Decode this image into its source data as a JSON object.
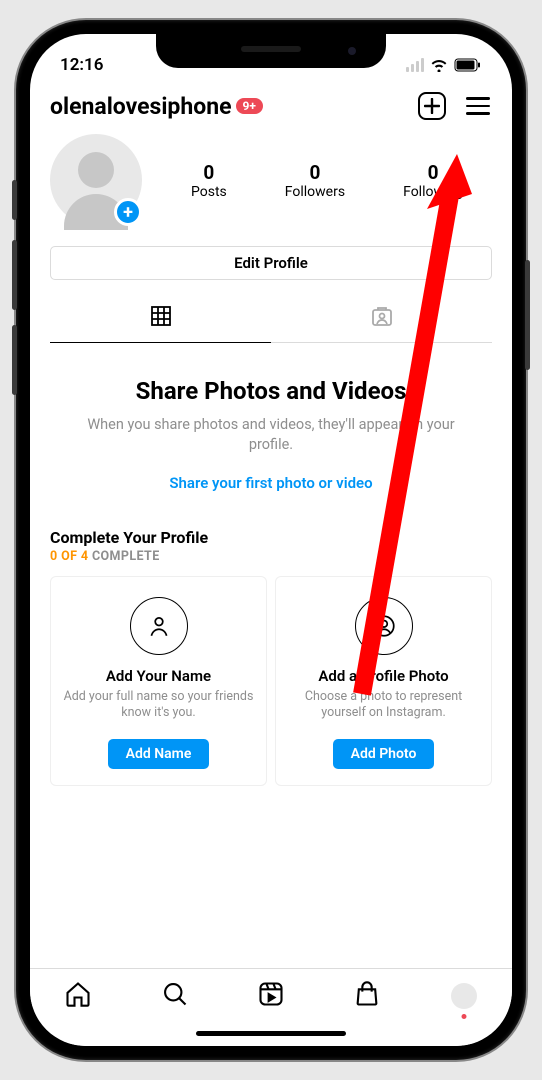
{
  "status": {
    "time": "12:16"
  },
  "header": {
    "username": "olenalovesiphone",
    "badge": "9+"
  },
  "stats": {
    "posts": {
      "count": "0",
      "label": "Posts"
    },
    "followers": {
      "count": "0",
      "label": "Followers"
    },
    "following": {
      "count": "0",
      "label": "Following"
    }
  },
  "editProfile": "Edit Profile",
  "empty": {
    "title": "Share Photos and Videos",
    "subtitle": "When you share photos and videos, they'll appear on your profile.",
    "link": "Share your first photo or video"
  },
  "complete": {
    "title": "Complete Your Profile",
    "progressDone": "0 OF 4",
    "progressRest": " COMPLETE"
  },
  "cards": [
    {
      "title": "Add Your Name",
      "subtitle": "Add your full name so your friends know it's you.",
      "button": "Add Name"
    },
    {
      "title": "Add a Profile Photo",
      "subtitle": "Choose a photo to represent yourself on Instagram.",
      "button": "Add Photo"
    }
  ]
}
